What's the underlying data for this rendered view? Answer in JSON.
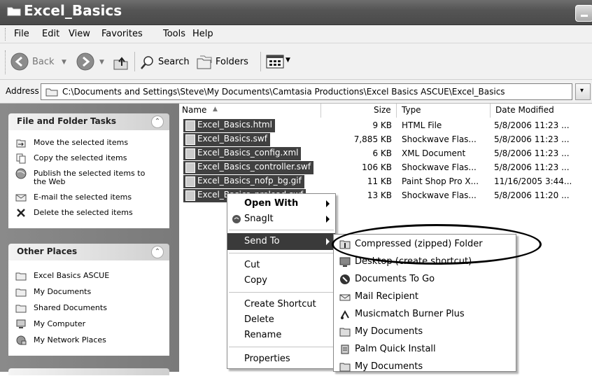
{
  "window": {
    "title": "Excel_Basics"
  },
  "menubar": {
    "items": [
      "File",
      "Edit",
      "View",
      "Favorites",
      "Tools",
      "Help"
    ]
  },
  "toolbar": {
    "back": "Back",
    "search": "Search",
    "folders": "Folders"
  },
  "address": {
    "label": "Address",
    "value": "C:\\Documents and Settings\\Steve\\My Documents\\Camtasia Productions\\Excel Basics ASCUE\\Excel_Basics"
  },
  "taskpane": {
    "file_folder_tasks": {
      "title": "File and Folder Tasks",
      "items": [
        "Move the selected items",
        "Copy the selected items",
        "Publish the selected items to the Web",
        "E-mail the selected items",
        "Delete the selected items"
      ]
    },
    "other_places": {
      "title": "Other Places",
      "items": [
        "Excel Basics ASCUE",
        "My Documents",
        "Shared Documents",
        "My Computer",
        "My Network Places"
      ]
    }
  },
  "filelist": {
    "columns": [
      "Name",
      "Size",
      "Type",
      "Date Modified"
    ],
    "rows": [
      {
        "name": "Excel_Basics.html",
        "size": "9 KB",
        "type": "HTML File",
        "date": "5/8/2006 11:23 ..."
      },
      {
        "name": "Excel_Basics.swf",
        "size": "7,885 KB",
        "type": "Shockwave Flas...",
        "date": "5/8/2006 11:23 ..."
      },
      {
        "name": "Excel_Basics_config.xml",
        "size": "6 KB",
        "type": "XML Document",
        "date": "5/8/2006 11:23 ..."
      },
      {
        "name": "Excel_Basics_controller.swf",
        "size": "106 KB",
        "type": "Shockwave Flas...",
        "date": "5/8/2006 11:23 ..."
      },
      {
        "name": "Excel_Basics_nofp_bg.gif",
        "size": "11 KB",
        "type": "Paint Shop Pro X...",
        "date": "11/16/2005 3:44..."
      },
      {
        "name": "Excel_Basics_preload.swf",
        "size": "13 KB",
        "type": "Shockwave Flas...",
        "date": "5/8/2006 11:20 ..."
      }
    ]
  },
  "context_menu": {
    "open_with": "Open With",
    "snagit": "SnagIt",
    "send_to": "Send To",
    "cut": "Cut",
    "copy": "Copy",
    "create_shortcut": "Create Shortcut",
    "delete": "Delete",
    "rename": "Rename",
    "properties": "Properties"
  },
  "send_to_menu": {
    "items": [
      "Compressed (zipped) Folder",
      "Desktop (create shortcut)",
      "Documents To Go",
      "Mail Recipient",
      "Musicmatch Burner Plus",
      "My Documents",
      "Palm Quick Install",
      "My Documents"
    ]
  }
}
